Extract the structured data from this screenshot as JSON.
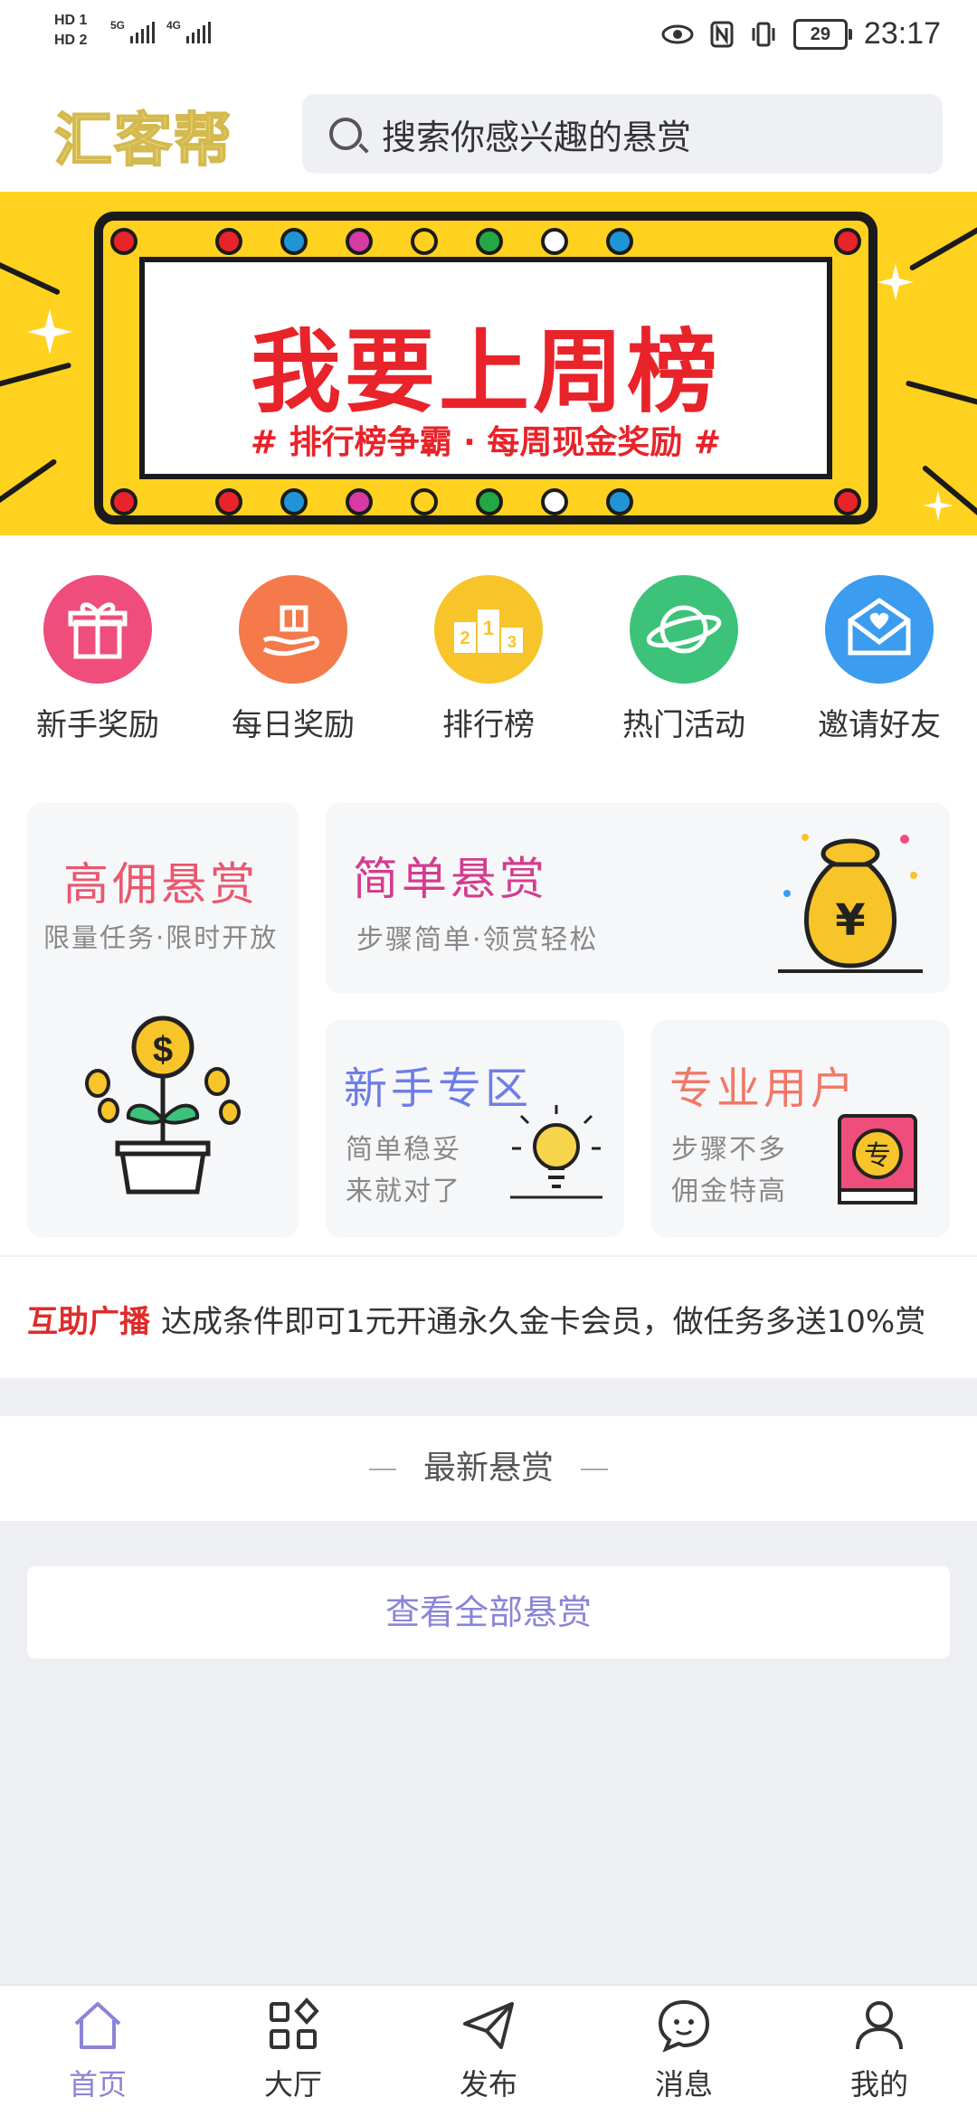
{
  "status_bar": {
    "hd1": "HD 1",
    "hd2": "HD 2",
    "net1": "5G",
    "net2": "4G",
    "battery": "29",
    "time": "23:17"
  },
  "header": {
    "logo": "汇客帮",
    "search_placeholder": "搜索你感兴趣的悬赏"
  },
  "banner": {
    "title": "我要上周榜",
    "subtitle": "# 排行榜争霸 · 每周现金奖励 #",
    "active_slide": 2,
    "slide_count": 3
  },
  "categories": [
    {
      "label": "新手奖励",
      "icon": "gift-icon",
      "color": "#ef4d7b"
    },
    {
      "label": "每日奖励",
      "icon": "hand-gift-icon",
      "color": "#f4794b"
    },
    {
      "label": "排行榜",
      "icon": "podium-icon",
      "color": "#f7c52a"
    },
    {
      "label": "热门活动",
      "icon": "planet-icon",
      "color": "#3dc27a"
    },
    {
      "label": "邀请好友",
      "icon": "envelope-heart-icon",
      "color": "#3b9cf0"
    }
  ],
  "features": {
    "high": {
      "title": "高佣悬赏",
      "subtitle": "限量任务·限时开放",
      "color": "#e9576e"
    },
    "simple": {
      "title": "简单悬赏",
      "subtitle": "步骤简单·领赏轻松",
      "color": "#d43c8f"
    },
    "newbie": {
      "title": "新手专区",
      "line1": "简单稳妥",
      "line2": "来就对了",
      "color": "#6e7de6"
    },
    "pro": {
      "title": "专业用户",
      "line1": "步骤不多",
      "line2": "佣金特高",
      "color": "#f07866",
      "badge": "专"
    }
  },
  "broadcast": {
    "label": "互助广播",
    "text": "达成条件即可1元开通永久金卡会员，做任务多送10%赏"
  },
  "latest": {
    "title": "最新悬赏"
  },
  "view_all": "查看全部悬赏",
  "nav": [
    {
      "label": "首页",
      "icon": "home-icon",
      "active": true
    },
    {
      "label": "大厅",
      "icon": "grid-icon",
      "active": false
    },
    {
      "label": "发布",
      "icon": "paper-plane-icon",
      "active": false
    },
    {
      "label": "消息",
      "icon": "chat-bubble-icon",
      "active": false
    },
    {
      "label": "我的",
      "icon": "user-icon",
      "active": false
    }
  ],
  "colors": {
    "accent": "#8b84d7",
    "banner": "#ffd21f",
    "banner_text": "#e8232a",
    "broadcast_label": "#e02b2b"
  }
}
